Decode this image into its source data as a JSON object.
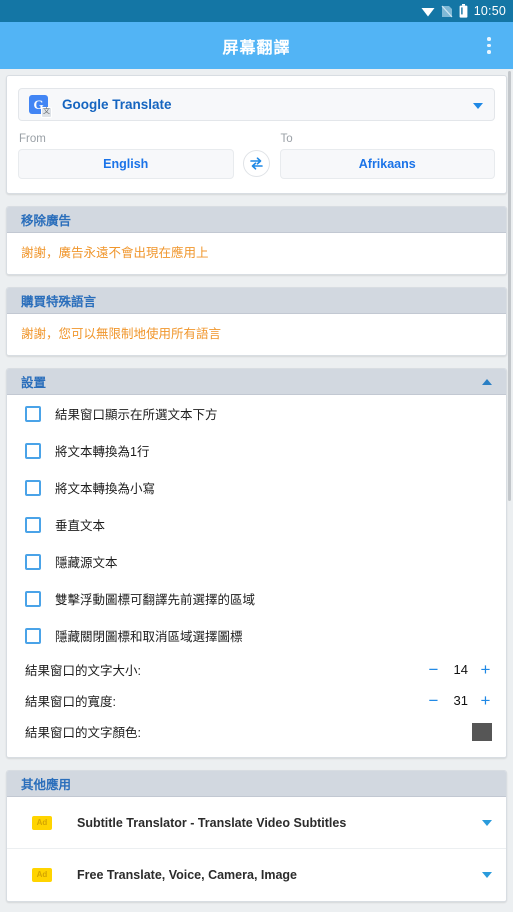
{
  "statusbar": {
    "time": "10:50",
    "icons": [
      "wifi-icon",
      "no-sim-icon",
      "battery-icon"
    ]
  },
  "appbar": {
    "title": "屏幕翻譯",
    "overflow_icon": "more-vert-icon"
  },
  "provider": {
    "icon": "google-translate-icon",
    "name": "Google Translate",
    "dropdown_icon": "chevron-down-icon",
    "from_label": "From",
    "from_value": "English",
    "to_label": "To",
    "to_value": "Afrikaans",
    "swap_icon": "swap-horizontal-icon"
  },
  "remove_ads": {
    "title": "移除廣告",
    "message": "謝謝，廣告永遠不會出現在應用上"
  },
  "buy_languages": {
    "title": "購買特殊語言",
    "message": "謝謝，您可以無限制地使用所有語言"
  },
  "settings": {
    "title": "設置",
    "collapse_icon": "chevron-up-icon",
    "checkboxes": [
      {
        "label": "結果窗口顯示在所選文本下方",
        "checked": false
      },
      {
        "label": "將文本轉換為1行",
        "checked": false
      },
      {
        "label": "將文本轉換為小寫",
        "checked": false
      },
      {
        "label": "垂直文本",
        "checked": false
      },
      {
        "label": "隱藏源文本",
        "checked": false
      },
      {
        "label": "雙擊浮動圖標可翻譯先前選擇的區域",
        "checked": false
      },
      {
        "label": "隱藏關閉圖標和取消區域選擇圖標",
        "checked": false
      }
    ],
    "steppers": [
      {
        "label": "結果窗口的文字大小:",
        "minus": "−",
        "value": "14",
        "plus": "+"
      },
      {
        "label": "結果窗口的寬度:",
        "minus": "−",
        "value": "31",
        "plus": "+"
      }
    ],
    "color_row": {
      "label": "結果窗口的文字顏色:",
      "color": "#565656"
    }
  },
  "other_apps": {
    "title": "其他應用",
    "items": [
      {
        "badge": "Ad",
        "title": "Subtitle Translator - Translate Video Subtitles",
        "caret": "chevron-down-icon"
      },
      {
        "badge": "Ad",
        "title": "Free Translate, Voice, Camera, Image",
        "caret": "chevron-down-icon"
      }
    ]
  },
  "colors": {
    "statusbar": "#1476a5",
    "appbar": "#52b4f5",
    "section_header": "#d2d8e0",
    "accent_blue": "#1e88e5",
    "info_orange": "#f0962c",
    "ad_badge": "#ffd400"
  }
}
